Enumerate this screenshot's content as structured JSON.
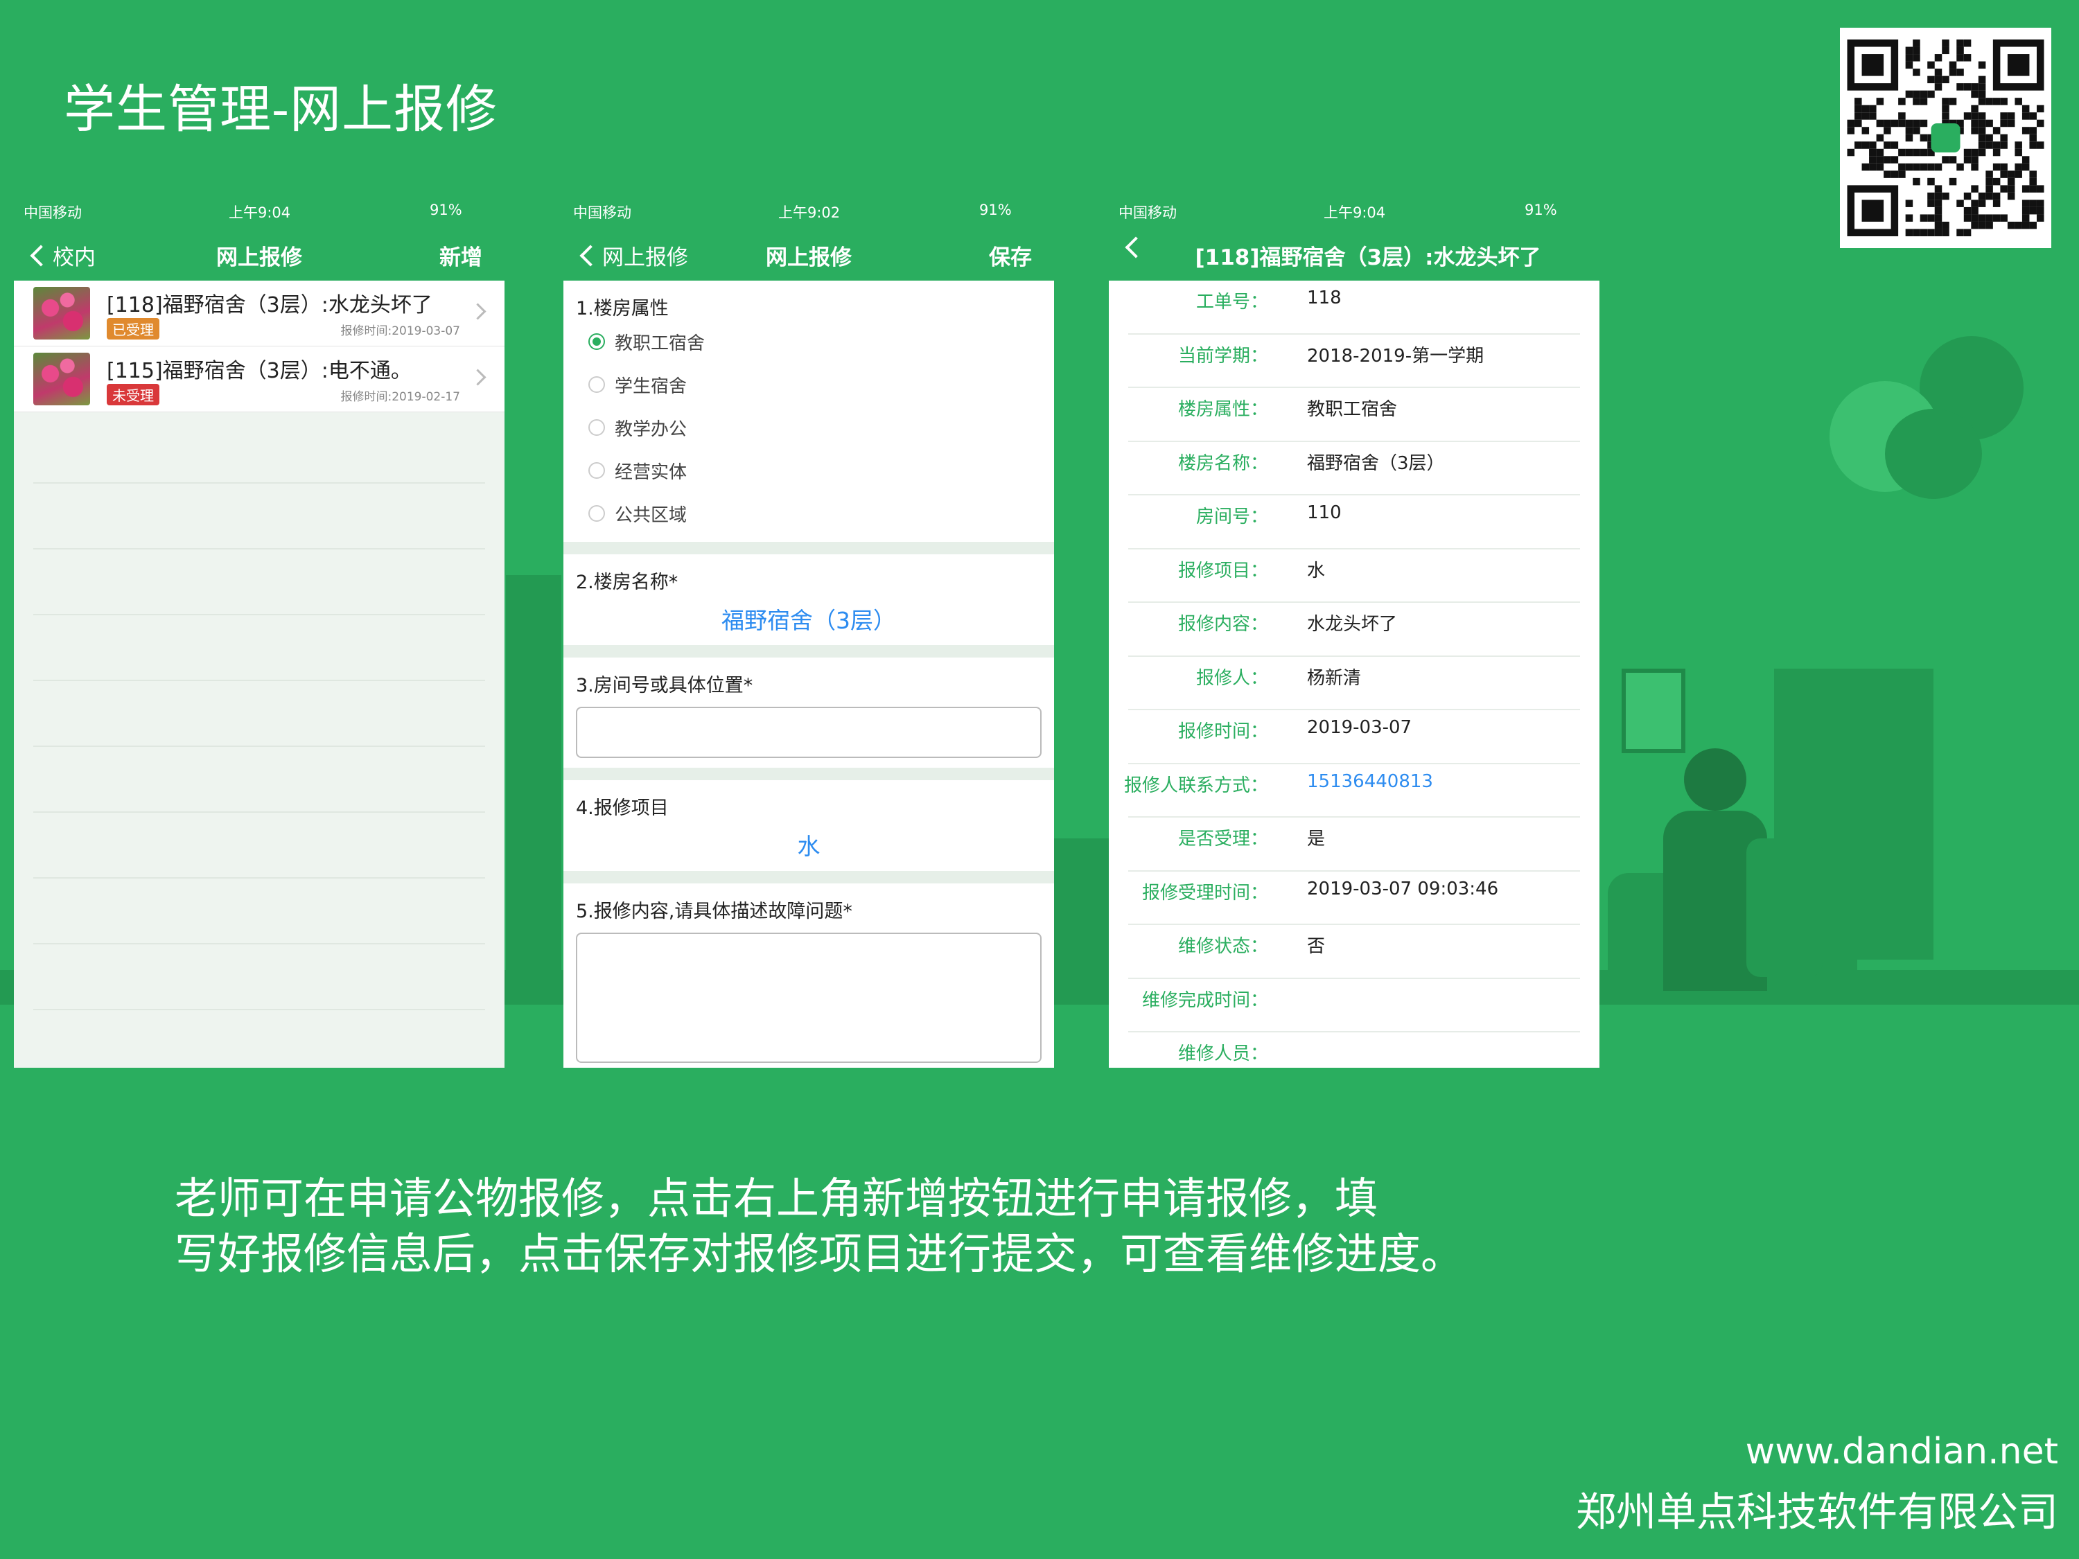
{
  "slide": {
    "title": "学生管理-网上报修"
  },
  "status_bars": [
    {
      "carrier": "中国移动",
      "time": "上午9:04",
      "battery": "91%"
    },
    {
      "carrier": "中国移动",
      "time": "上午9:02",
      "battery": "91%"
    },
    {
      "carrier": "中国移动",
      "time": "上午9:04",
      "battery": "91%"
    }
  ],
  "screen1": {
    "nav": {
      "back": "校内",
      "title": "网上报修",
      "action": "新增"
    },
    "items": [
      {
        "title": "[118]福野宿舍（3层）:水龙头坏了",
        "status": "已受理",
        "status_color": "#e08a2e",
        "time": "报修时间:2019-03-07"
      },
      {
        "title": "[115]福野宿舍（3层）:电不通。",
        "status": "未受理",
        "status_color": "#d9383a",
        "time": "报修时间:2019-02-17"
      }
    ]
  },
  "screen2": {
    "nav": {
      "back": "网上报修",
      "title": "网上报修",
      "action": "保存"
    },
    "q1": {
      "label": "1.楼房属性",
      "options": [
        "教职工宿舍",
        "学生宿舍",
        "教学办公",
        "经营实体",
        "公共区域"
      ],
      "selected": "教职工宿舍"
    },
    "q2": {
      "label": "2.楼房名称*",
      "value": "福野宿舍（3层）"
    },
    "q3": {
      "label": "3.房间号或具体位置*",
      "value": ""
    },
    "q4": {
      "label": "4.报修项目",
      "value": "水"
    },
    "q5": {
      "label": "5.报修内容,请具体描述故障问题*",
      "value": ""
    }
  },
  "screen3": {
    "nav": {
      "title": "[118]福野宿舍（3层）:水龙头坏了"
    },
    "rows": [
      {
        "label": "工单号：",
        "value": "118"
      },
      {
        "label": "当前学期：",
        "value": "2018-2019-第一学期"
      },
      {
        "label": "楼房属性：",
        "value": "教职工宿舍"
      },
      {
        "label": "楼房名称：",
        "value": "福野宿舍（3层）"
      },
      {
        "label": "房间号：",
        "value": "110"
      },
      {
        "label": "报修项目：",
        "value": "水"
      },
      {
        "label": "报修内容：",
        "value": "水龙头坏了"
      },
      {
        "label": "报修人：",
        "value": "杨新清"
      },
      {
        "label": "报修时间：",
        "value": "2019-03-07"
      },
      {
        "label": "报修人联系方式：",
        "value": "15136440813"
      },
      {
        "label": "是否受理：",
        "value": "是"
      },
      {
        "label": "报修受理时间：",
        "value": "2019-03-07 09:03:46"
      },
      {
        "label": "维修状态：",
        "value": "否"
      },
      {
        "label": "维修完成时间：",
        "value": ""
      },
      {
        "label": "维修人员：",
        "value": ""
      }
    ],
    "link_color": "#2d8cf0"
  },
  "caption": {
    "line1": "老师可在申请公物报修，点击右上角新增按钮进行申请报修，填",
    "line2": "写好报修信息后，点击保存对报修项目进行提交，可查看维修进度。"
  },
  "footer": {
    "url": "www.dandian.net",
    "company": "郑州单点科技软件有限公司"
  },
  "colors": {
    "brand_green": "#2aae5f",
    "link_blue": "#2d8cf0"
  }
}
